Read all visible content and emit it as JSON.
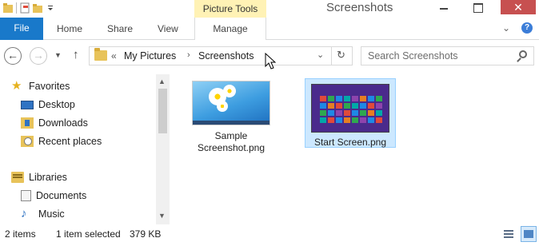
{
  "window": {
    "title": "Screenshots",
    "context_tab_header": "Picture Tools",
    "controls": {
      "minimize": "",
      "maximize": "",
      "close": "✕"
    }
  },
  "ribbon": {
    "file_tab": "File",
    "tabs": [
      "Home",
      "Share",
      "View",
      "Manage"
    ],
    "collapse_glyph": "⌄",
    "help_glyph": "?"
  },
  "address_bar": {
    "overflow_glyph": "«",
    "breadcrumbs": [
      "My Pictures",
      "Screenshots"
    ],
    "separator": "›",
    "dropdown_glyph": "⌄",
    "refresh_glyph": "↻"
  },
  "search": {
    "placeholder": "Search Screenshots"
  },
  "nav_buttons": {
    "back": "←",
    "forward": "→",
    "recent": "▼",
    "up": "↑"
  },
  "navigation_pane": {
    "items": [
      {
        "label": "Favorites",
        "icon": "star-icon"
      },
      {
        "label": "Desktop",
        "icon": "desktop-icon"
      },
      {
        "label": "Downloads",
        "icon": "downloads-icon"
      },
      {
        "label": "Recent places",
        "icon": "recent-places-icon"
      },
      {
        "label": "Libraries",
        "icon": "libraries-icon"
      },
      {
        "label": "Documents",
        "icon": "documents-icon"
      },
      {
        "label": "Music",
        "icon": "music-icon"
      }
    ],
    "scroll_up": "▲",
    "scroll_down": "▼"
  },
  "files": [
    {
      "name": "Sample Screenshot.png",
      "selected": false
    },
    {
      "name": "Start Screen.png",
      "selected": true
    }
  ],
  "status_bar": {
    "item_count": "2 items",
    "selection": "1 item selected",
    "size": "379 KB"
  },
  "colors": {
    "file_tab": "#1979ca",
    "context_tab": "#fff2b5",
    "selection_fill": "#cce8ff",
    "selection_border": "#99d1ff",
    "close_button": "#c75050"
  }
}
